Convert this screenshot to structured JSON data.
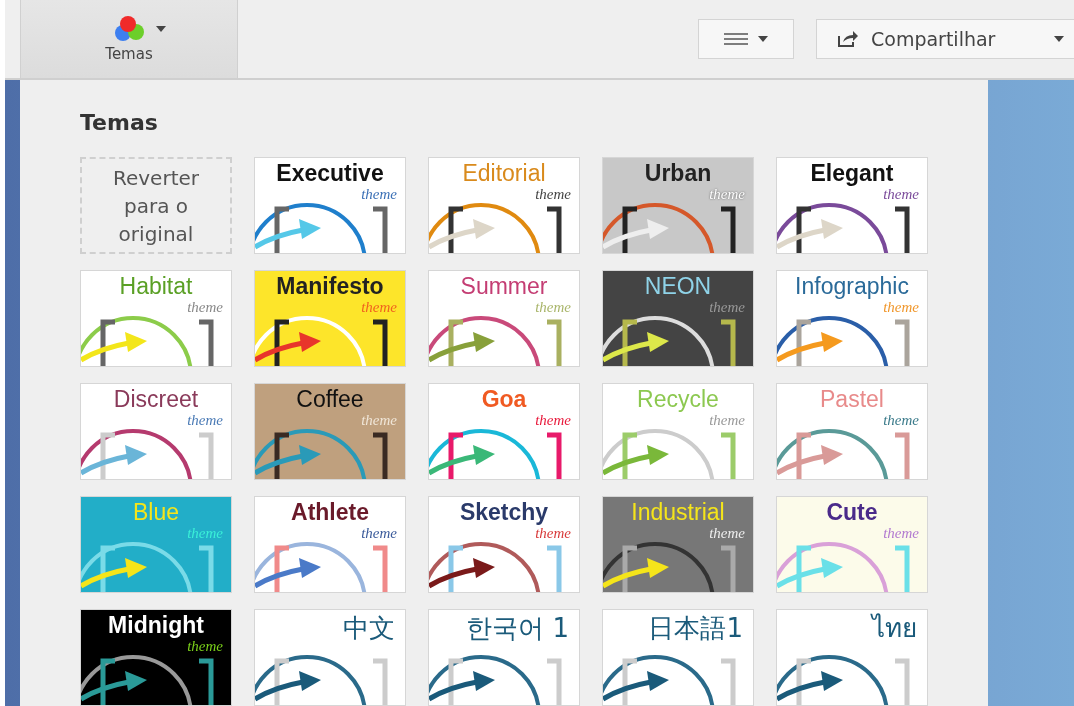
{
  "toolbar": {
    "themes_button": {
      "label": "Temas"
    },
    "share_button": {
      "label": "Compartilhar"
    }
  },
  "panel": {
    "title": "Temas",
    "revert": {
      "label": "Reverter para o original"
    },
    "themes": [
      {
        "kind": "theme",
        "name": "Executive",
        "subtitle": "theme",
        "bold": true,
        "color": "#ffffff"
      },
      {
        "kind": "theme",
        "name": "Editorial",
        "subtitle": "theme",
        "bold": false,
        "color": "#ffffff"
      },
      {
        "kind": "theme",
        "name": "Urban",
        "subtitle": "theme",
        "bold": true,
        "color": "#c8c8c8"
      },
      {
        "kind": "theme",
        "name": "Elegant",
        "subtitle": "theme",
        "bold": true,
        "color": "#ffffff"
      },
      {
        "kind": "theme",
        "name": "Habitat",
        "subtitle": "theme",
        "bold": false,
        "color": "#ffffff"
      },
      {
        "kind": "theme",
        "name": "Manifesto",
        "subtitle": "theme",
        "bold": true,
        "color": "#fde52a"
      },
      {
        "kind": "theme",
        "name": "Summer",
        "subtitle": "theme",
        "bold": false,
        "color": "#ffffff"
      },
      {
        "kind": "theme",
        "name": "NEON",
        "subtitle": "theme",
        "bold": false,
        "color": "#444444"
      },
      {
        "kind": "theme",
        "name": "Infographic",
        "subtitle": "theme",
        "bold": false,
        "color": "#ffffff"
      },
      {
        "kind": "theme",
        "name": "Discreet",
        "subtitle": "theme",
        "bold": false,
        "color": "#ffffff"
      },
      {
        "kind": "theme",
        "name": "Coffee",
        "subtitle": "theme",
        "bold": false,
        "color": "#bfa07e"
      },
      {
        "kind": "theme",
        "name": "Goa",
        "subtitle": "theme",
        "bold": true,
        "color": "#ffffff"
      },
      {
        "kind": "theme",
        "name": "Recycle",
        "subtitle": "theme",
        "bold": false,
        "color": "#ffffff"
      },
      {
        "kind": "theme",
        "name": "Pastel",
        "subtitle": "theme",
        "bold": false,
        "color": "#ffffff"
      },
      {
        "kind": "theme",
        "name": "Blue",
        "subtitle": "theme",
        "bold": false,
        "color": "#22aec8"
      },
      {
        "kind": "theme",
        "name": "Athlete",
        "subtitle": "theme",
        "bold": true,
        "color": "#ffffff"
      },
      {
        "kind": "theme",
        "name": "Sketchy",
        "subtitle": "theme",
        "bold": true,
        "color": "#ffffff"
      },
      {
        "kind": "theme",
        "name": "Industrial",
        "subtitle": "theme",
        "bold": false,
        "color": "#777777"
      },
      {
        "kind": "theme",
        "name": "Cute",
        "subtitle": "theme",
        "bold": true,
        "color": "#fcfbea"
      },
      {
        "kind": "theme",
        "name": "Midnight",
        "subtitle": "theme",
        "bold": true,
        "color": "#000000"
      },
      {
        "kind": "language",
        "name": "中文",
        "color": "#ffffff"
      },
      {
        "kind": "language",
        "name": "한국어 1",
        "color": "#ffffff"
      },
      {
        "kind": "language",
        "name": "日本語1",
        "color": "#ffffff"
      },
      {
        "kind": "language",
        "name": "ไทย",
        "color": "#ffffff"
      }
    ]
  }
}
